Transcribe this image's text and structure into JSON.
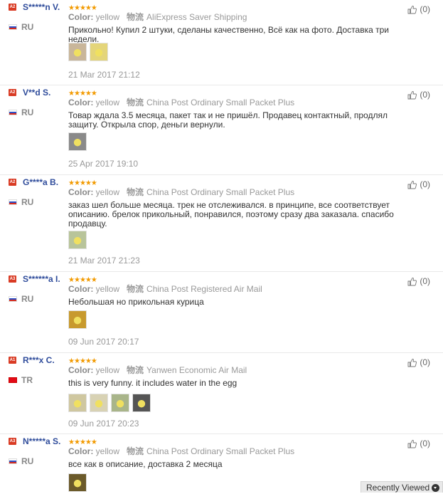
{
  "reviews": [
    {
      "badge": "A2",
      "user": "S*****n V.",
      "country": "RU",
      "stars": 5,
      "color_label": "Color:",
      "color_value": "yellow",
      "logistics_label": "物流",
      "shipping": "AliExpress Saver Shipping",
      "text": "Прикольно! Купил 2 штуки, сделаны качественно, Всё как на фото. Доставка три недели.",
      "photos": [
        {
          "bg": "#c9b69a"
        },
        {
          "bg": "#e4d57a"
        }
      ],
      "date": "21 Mar 2017 21:12",
      "helpful_count": "(0)"
    },
    {
      "badge": "A2",
      "user": "V**d S.",
      "country": "RU",
      "stars": 5,
      "color_label": "Color:",
      "color_value": "yellow",
      "logistics_label": "物流",
      "shipping": "China Post Ordinary Small Packet Plus",
      "text": "Товар ждала 3.5 месяца, пакет так и не пришёл. Продавец контактный, продлял защиту. Открыла спор, деньги вернули.",
      "photos": [
        {
          "bg": "#8a8a8a"
        }
      ],
      "date": "25 Apr 2017 19:10",
      "helpful_count": "(0)"
    },
    {
      "badge": "A2",
      "user": "G****a B.",
      "country": "RU",
      "stars": 5,
      "color_label": "Color:",
      "color_value": "yellow",
      "logistics_label": "物流",
      "shipping": "China Post Ordinary Small Packet Plus",
      "text": "заказ шел больше месяца. трек не отслеживался. в принципе, все соответствует описанию. брелок прикольный, понравился, поэтому сразу два заказала. спасибо продавцу.",
      "photos": [
        {
          "bg": "#b8c49a"
        }
      ],
      "date": "21 Mar 2017 21:23",
      "helpful_count": "(0)"
    },
    {
      "badge": "A3",
      "user": "S******a I.",
      "country": "RU",
      "stars": 5,
      "color_label": "Color:",
      "color_value": "yellow",
      "logistics_label": "物流",
      "shipping": "China Post Registered Air Mail",
      "text": "Небольшая но прикольная курица",
      "photos": [
        {
          "bg": "#c89a2e"
        }
      ],
      "date": "09 Jun 2017 20:17",
      "helpful_count": "(0)"
    },
    {
      "badge": "A1",
      "user": "R***x C.",
      "country": "TR",
      "stars": 5,
      "color_label": "Color:",
      "color_value": "yellow",
      "logistics_label": "物流",
      "shipping": "Yanwen Economic Air Mail",
      "text": "this is very funny. it includes water in the egg",
      "photos": [
        {
          "bg": "#cfc7a0"
        },
        {
          "bg": "#d8d2b4"
        },
        {
          "bg": "#a9b58a"
        },
        {
          "bg": "#555555"
        }
      ],
      "date": "09 Jun 2017 20:23",
      "helpful_count": "(0)"
    },
    {
      "badge": "A3",
      "user": "N*****a S.",
      "country": "RU",
      "stars": 5,
      "color_label": "Color:",
      "color_value": "yellow",
      "logistics_label": "物流",
      "shipping": "China Post Ordinary Small Packet Plus",
      "text": "все как в описание, доставка 2 месяца",
      "photos": [
        {
          "bg": "#6b5a2a"
        }
      ],
      "date": "",
      "helpful_count": "(0)"
    }
  ],
  "recently_viewed": {
    "label": "Recently Viewed"
  },
  "colors": {
    "username": "#2f4c9b",
    "star": "#f29a00",
    "badge": "#d93b24"
  }
}
